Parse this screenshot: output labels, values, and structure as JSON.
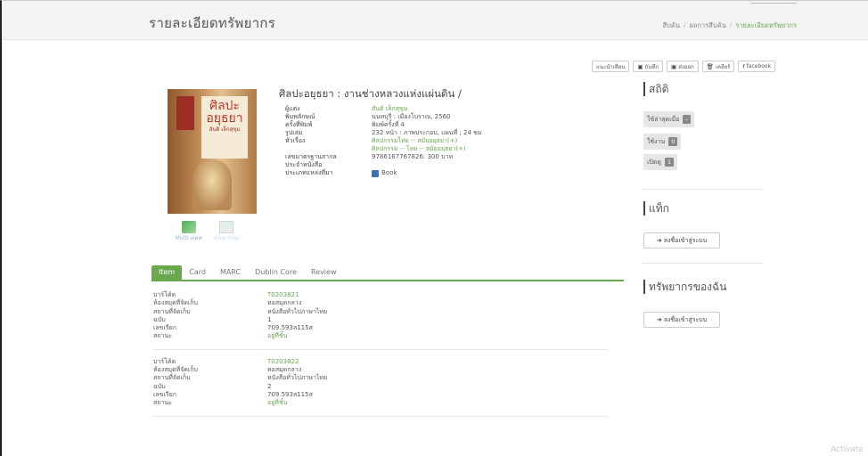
{
  "header": {
    "title": "รายละเอียดทรัพยากร",
    "breadcrumb": [
      "สืบค้น",
      "ผลการสืบค้น",
      "รายละเอียดทรัพยากร"
    ]
  },
  "toolbar": {
    "recommend": "แนะนำเพื่อน",
    "save": "บันทึก",
    "export": "ส่งออก",
    "clear": "เคลียร์",
    "facebook": "facebook"
  },
  "cover": {
    "line1": "ศิลปะ",
    "line2": "อยุธยา",
    "author": "สันติ เล็กสุขุม"
  },
  "views": {
    "multi": "Multi view",
    "map": "View map"
  },
  "book": {
    "title": "ศิลปะอยุธยา : งานช่างหลวงแห่งแผ่นดิน /",
    "fields": [
      {
        "label": "ผู้แต่ง",
        "value": "สันติ เล็กสุขุม",
        "link": true
      },
      {
        "label": "พิมพลักษณ์",
        "value": "นนทบุรี : เมืองโบราณ, 2560",
        "link": false
      },
      {
        "label": "ครั้งที่พิมพ์",
        "value": "พิมพ์ครั้งที่ 4",
        "link": false
      },
      {
        "label": "รูปเล่ม",
        "value": "232 หน้า : ภาพประกอบ, แผนที่ ; 24 ซม",
        "link": false
      },
      {
        "label": "หัวเรื่อง",
        "value": "ศิลปกรรมไทย -- สมัยอยุธยา(+)",
        "link": true
      },
      {
        "label": "",
        "value": "ศิลปกรรม -- ไทย -- สมัยอยุธยา(+)",
        "link": true
      },
      {
        "label": "เลขมาตรฐานสากล",
        "value": "9786167767826: 300 บาท",
        "link": false
      },
      {
        "label": "ประจำหนังสือ",
        "value": "",
        "link": false
      },
      {
        "label": "ประเภทแหล่งที่มา",
        "value": "Book",
        "link": false
      }
    ]
  },
  "tabs": [
    "Item",
    "Card",
    "MARC",
    "Dublin Core",
    "Review"
  ],
  "item_labels": [
    "บาร์โค้ด",
    "ห้องสมุดที่จัดเก็บ",
    "สถานที่จัดเก็บ",
    "ฉบับ",
    "เลขเรียก",
    "สถานะ"
  ],
  "items": [
    {
      "barcode": "T0203821",
      "library": "หอสมุดกลาง",
      "location": "หนังสือทั่วไปภาษาไทย",
      "copy": "1",
      "callno": "709.593ส115ส",
      "status": "อยู่ที่ชั้น"
    },
    {
      "barcode": "T0203822",
      "library": "หอสมุดกลาง",
      "location": "หนังสือทั่วไปภาษาไทย",
      "copy": "2",
      "callno": "709.593ส115ส",
      "status": "อยู่ที่ชั้น"
    }
  ],
  "sidebar": {
    "stats_title": "สถิติ",
    "stats": [
      {
        "label": "ใช้ล่าสุดเมื่อ",
        "value": "-"
      },
      {
        "label": "ใช้งาน",
        "value": "0"
      },
      {
        "label": "เปิดดู",
        "value": "1"
      }
    ],
    "shelf_title": "แท็ก",
    "login_label": "ลงชื่อเข้าสู่ระบบ",
    "my_title": "ทรัพยากรของฉัน",
    "login_label2": "ลงชื่อเข้าสู่ระบบ"
  },
  "watermark": "Activate"
}
